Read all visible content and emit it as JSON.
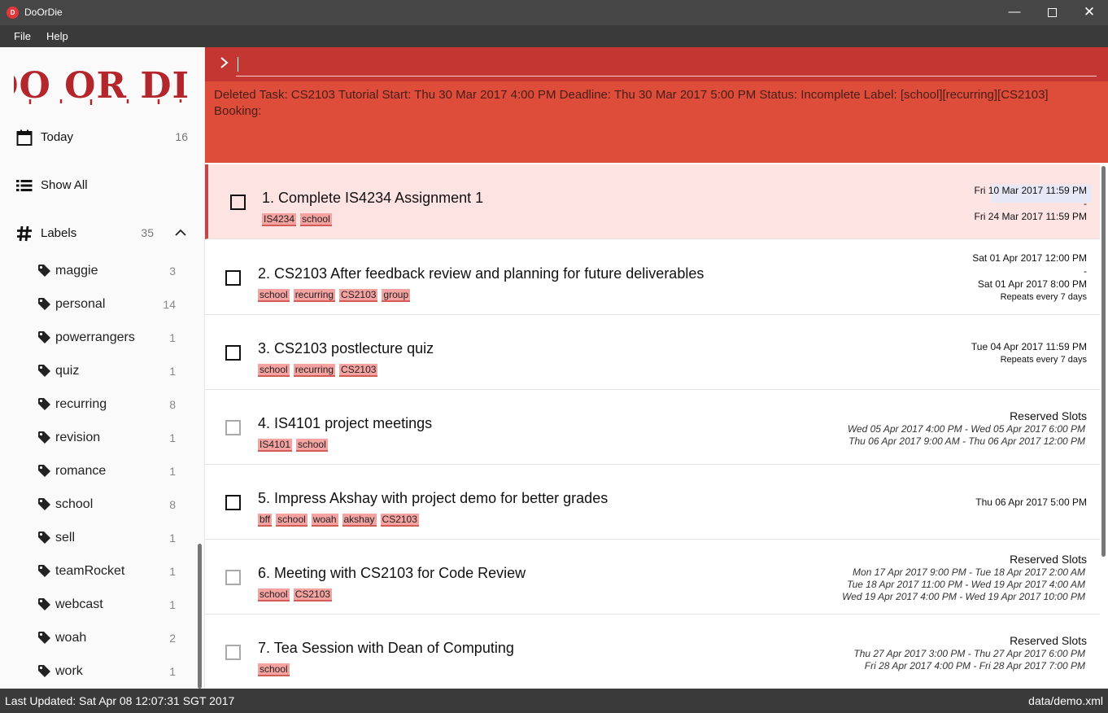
{
  "window": {
    "title": "DoOrDie",
    "icon_text": "D",
    "buttons": {
      "minimize": "—",
      "close": "✕"
    }
  },
  "menu": {
    "items": [
      "File",
      "Help"
    ]
  },
  "sidebar": {
    "logo_text": "DO OR DIE",
    "today": {
      "label": "Today",
      "count": "16"
    },
    "show_all": {
      "label": "Show All"
    },
    "labels_header": {
      "label": "Labels",
      "count": "35"
    },
    "labels": [
      {
        "name": "maggie",
        "count": "3"
      },
      {
        "name": "personal",
        "count": "14"
      },
      {
        "name": "powerrangers",
        "count": "1"
      },
      {
        "name": "quiz",
        "count": "1"
      },
      {
        "name": "recurring",
        "count": "8"
      },
      {
        "name": "revision",
        "count": "1"
      },
      {
        "name": "romance",
        "count": "1"
      },
      {
        "name": "school",
        "count": "8"
      },
      {
        "name": "sell",
        "count": "1"
      },
      {
        "name": "teamRocket",
        "count": "1"
      },
      {
        "name": "webcast",
        "count": "1"
      },
      {
        "name": "woah",
        "count": "2"
      },
      {
        "name": "work",
        "count": "1"
      }
    ]
  },
  "command": {
    "value": "",
    "result": "Deleted Task: CS2103 Tutorial Start: Thu 30 Mar 2017 4:00 PM Deadline: Thu 30 Mar 2017 5:00 PM Status: Incomplete Label: [school][recurring][CS2103] Booking:"
  },
  "tasks": [
    {
      "title": "1. Complete IS4234 Assignment 1",
      "tags": [
        "IS4234",
        "school"
      ],
      "start": "Fri 10 Mar 2017 11:59 PM",
      "dash": "-",
      "end": "Fri 24 Mar 2017 11:59 PM"
    },
    {
      "title": "2. CS2103 After feedback review and planning for future deliverables",
      "tags": [
        "school",
        "recurring",
        "CS2103",
        "group"
      ],
      "start": "Sat 01 Apr 2017 12:00 PM",
      "dash": "-",
      "end": "Sat 01 Apr 2017 8:00 PM",
      "repeat": "Repeats every 7 days"
    },
    {
      "title": "3. CS2103 postlecture quiz",
      "tags": [
        "school",
        "recurring",
        "CS2103"
      ],
      "end": "Tue 04 Apr 2017 11:59 PM",
      "repeat": "Repeats every 7 days"
    },
    {
      "title": "4. IS4101 project meetings",
      "tags": [
        "IS4101",
        "school"
      ],
      "slots_header": "Reserved Slots",
      "slots": [
        "Wed 05 Apr 2017 4:00 PM - Wed 05 Apr 2017 6:00 PM",
        "Thu 06 Apr 2017 9:00 AM - Thu 06 Apr 2017 12:00 PM"
      ]
    },
    {
      "title": "5. Impress Akshay with project demo for better grades",
      "tags": [
        "bff",
        "school",
        "woah",
        "akshay",
        "CS2103"
      ],
      "end": "Thu 06 Apr 2017 5:00 PM"
    },
    {
      "title": "6. Meeting with CS2103 for Code Review",
      "tags": [
        "school",
        "CS2103"
      ],
      "slots_header": "Reserved Slots",
      "slots": [
        "Mon 17 Apr 2017 9:00 PM - Tue 18 Apr 2017 2:00 AM",
        "Tue 18 Apr 2017 11:00 PM - Wed 19 Apr 2017 4:00 AM",
        "Wed 19 Apr 2017 4:00 PM - Wed 19 Apr 2017 10:00 PM"
      ]
    },
    {
      "title": "7. Tea Session with Dean of Computing",
      "tags": [
        "school"
      ],
      "slots_header": "Reserved Slots",
      "slots": [
        "Thu 27 Apr 2017 3:00 PM - Thu 27 Apr 2017 6:00 PM",
        "Fri 28 Apr 2017 4:00 PM - Fri 28 Apr 2017 7:00 PM"
      ]
    }
  ],
  "status": {
    "last_updated": "Last Updated: Sat Apr 08 12:07:31 SGT 2017",
    "file": "data/demo.xml"
  },
  "colors": {
    "command_bar": "#c33632",
    "result_area": "#dd4d3a",
    "tag_bg": "#f5a3a1",
    "selected_row": "#fde4e3",
    "chrome": "#3a3a3a"
  }
}
